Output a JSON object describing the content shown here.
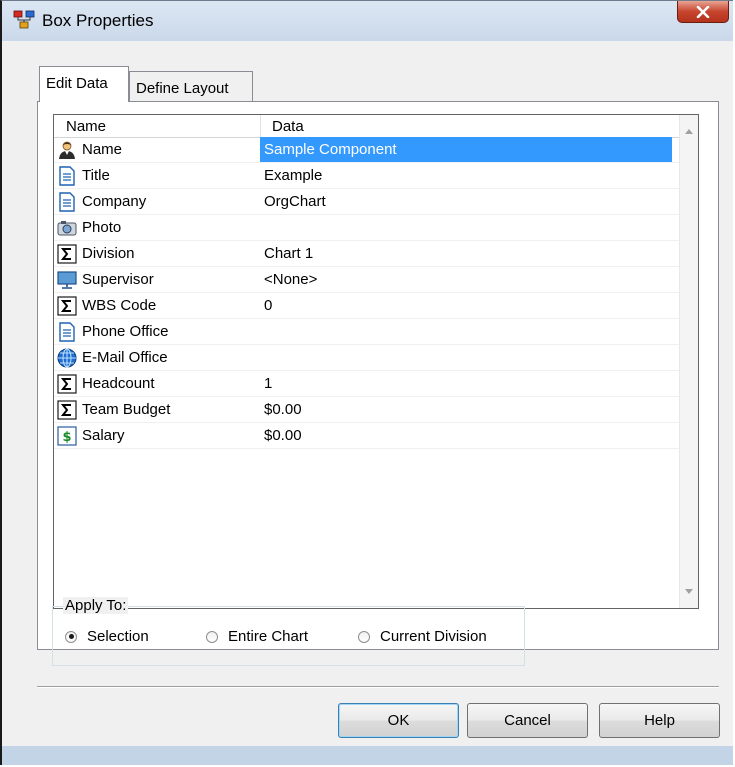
{
  "window": {
    "title": "Box Properties"
  },
  "tabs": [
    {
      "label": "Edit Data",
      "active": true
    },
    {
      "label": "Define Layout",
      "active": false
    }
  ],
  "grid": {
    "columns": [
      "Name",
      "Data"
    ],
    "rows": [
      {
        "icon": "person-icon",
        "name": "Name",
        "data": "Sample Component",
        "selected": true
      },
      {
        "icon": "document-icon",
        "name": "Title",
        "data": "Example"
      },
      {
        "icon": "document-icon",
        "name": "Company",
        "data": "OrgChart"
      },
      {
        "icon": "camera-icon",
        "name": "Photo",
        "data": ""
      },
      {
        "icon": "sigma-icon",
        "name": "Division",
        "data": "Chart 1"
      },
      {
        "icon": "monitor-icon",
        "name": "Supervisor",
        "data": "<None>"
      },
      {
        "icon": "sigma-icon",
        "name": "WBS Code",
        "data": "0"
      },
      {
        "icon": "document-icon",
        "name": "Phone Office",
        "data": ""
      },
      {
        "icon": "globe-icon",
        "name": "E-Mail Office",
        "data": ""
      },
      {
        "icon": "sigma-icon",
        "name": "Headcount",
        "data": "1"
      },
      {
        "icon": "sigma-icon",
        "name": "Team Budget",
        "data": "$0.00"
      },
      {
        "icon": "dollar-icon",
        "name": "Salary",
        "data": "$0.00"
      }
    ]
  },
  "apply_to": {
    "label": "Apply To:",
    "options": [
      {
        "label": "Selection",
        "checked": true
      },
      {
        "label": "Entire Chart",
        "checked": false
      },
      {
        "label": "Current Division",
        "checked": false
      }
    ]
  },
  "buttons": {
    "ok": "OK",
    "cancel": "Cancel",
    "help": "Help"
  },
  "colors": {
    "selection": "#3399ff",
    "close_button": "#c8452f",
    "title_bar": "#c9d8ea"
  }
}
